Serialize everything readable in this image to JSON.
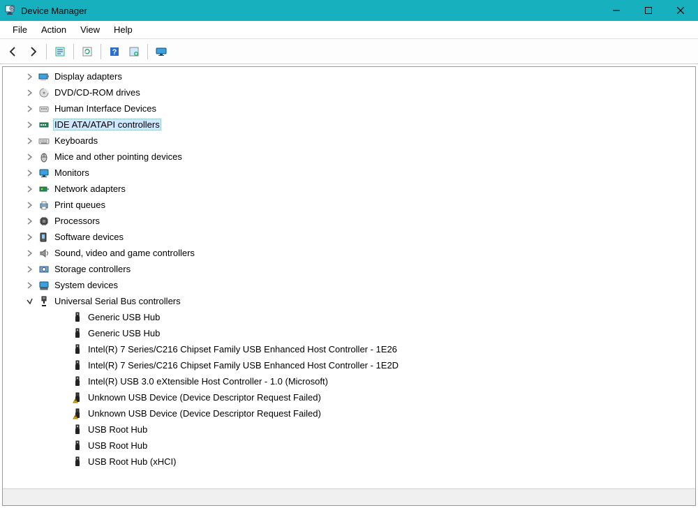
{
  "window": {
    "title": "Device Manager"
  },
  "menu": {
    "items": [
      "File",
      "Action",
      "View",
      "Help"
    ]
  },
  "toolbar": {
    "back": "Back",
    "forward": "Forward",
    "properties": "Properties",
    "refresh": "Refresh",
    "help": "Help",
    "action": "Action",
    "show_hidden": "Show hidden"
  },
  "tree": [
    {
      "label": "Display adapters",
      "icon": "display-adapter-icon",
      "expand": "closed",
      "indent": 0
    },
    {
      "label": "DVD/CD-ROM drives",
      "icon": "disc-drive-icon",
      "expand": "closed",
      "indent": 0
    },
    {
      "label": "Human Interface Devices",
      "icon": "hid-icon",
      "expand": "closed",
      "indent": 0
    },
    {
      "label": "IDE ATA/ATAPI controllers",
      "icon": "ide-controller-icon",
      "expand": "closed",
      "indent": 0,
      "selected": true
    },
    {
      "label": "Keyboards",
      "icon": "keyboard-icon",
      "expand": "closed",
      "indent": 0
    },
    {
      "label": "Mice and other pointing devices",
      "icon": "mouse-icon",
      "expand": "closed",
      "indent": 0
    },
    {
      "label": "Monitors",
      "icon": "monitor-icon",
      "expand": "closed",
      "indent": 0
    },
    {
      "label": "Network adapters",
      "icon": "network-adapter-icon",
      "expand": "closed",
      "indent": 0
    },
    {
      "label": "Print queues",
      "icon": "printer-icon",
      "expand": "closed",
      "indent": 0
    },
    {
      "label": "Processors",
      "icon": "processor-icon",
      "expand": "closed",
      "indent": 0
    },
    {
      "label": "Software devices",
      "icon": "software-device-icon",
      "expand": "closed",
      "indent": 0
    },
    {
      "label": "Sound, video and game controllers",
      "icon": "audio-icon",
      "expand": "closed",
      "indent": 0
    },
    {
      "label": "Storage controllers",
      "icon": "storage-controller-icon",
      "expand": "closed",
      "indent": 0
    },
    {
      "label": "System devices",
      "icon": "system-device-icon",
      "expand": "closed",
      "indent": 0
    },
    {
      "label": "Universal Serial Bus controllers",
      "icon": "usb-controller-icon",
      "expand": "open",
      "indent": 0
    },
    {
      "label": "Generic USB Hub",
      "icon": "usb-device-icon",
      "expand": "none",
      "indent": 1
    },
    {
      "label": "Generic USB Hub",
      "icon": "usb-device-icon",
      "expand": "none",
      "indent": 1
    },
    {
      "label": "Intel(R) 7 Series/C216 Chipset Family USB Enhanced Host Controller - 1E26",
      "icon": "usb-device-icon",
      "expand": "none",
      "indent": 1
    },
    {
      "label": "Intel(R) 7 Series/C216 Chipset Family USB Enhanced Host Controller - 1E2D",
      "icon": "usb-device-icon",
      "expand": "none",
      "indent": 1
    },
    {
      "label": "Intel(R) USB 3.0 eXtensible Host Controller - 1.0 (Microsoft)",
      "icon": "usb-device-icon",
      "expand": "none",
      "indent": 1
    },
    {
      "label": "Unknown USB Device (Device Descriptor Request Failed)",
      "icon": "usb-device-warning-icon",
      "expand": "none",
      "indent": 1
    },
    {
      "label": "Unknown USB Device (Device Descriptor Request Failed)",
      "icon": "usb-device-warning-icon",
      "expand": "none",
      "indent": 1
    },
    {
      "label": "USB Root Hub",
      "icon": "usb-device-icon",
      "expand": "none",
      "indent": 1
    },
    {
      "label": "USB Root Hub",
      "icon": "usb-device-icon",
      "expand": "none",
      "indent": 1
    },
    {
      "label": "USB Root Hub (xHCI)",
      "icon": "usb-device-icon",
      "expand": "none",
      "indent": 1
    }
  ]
}
